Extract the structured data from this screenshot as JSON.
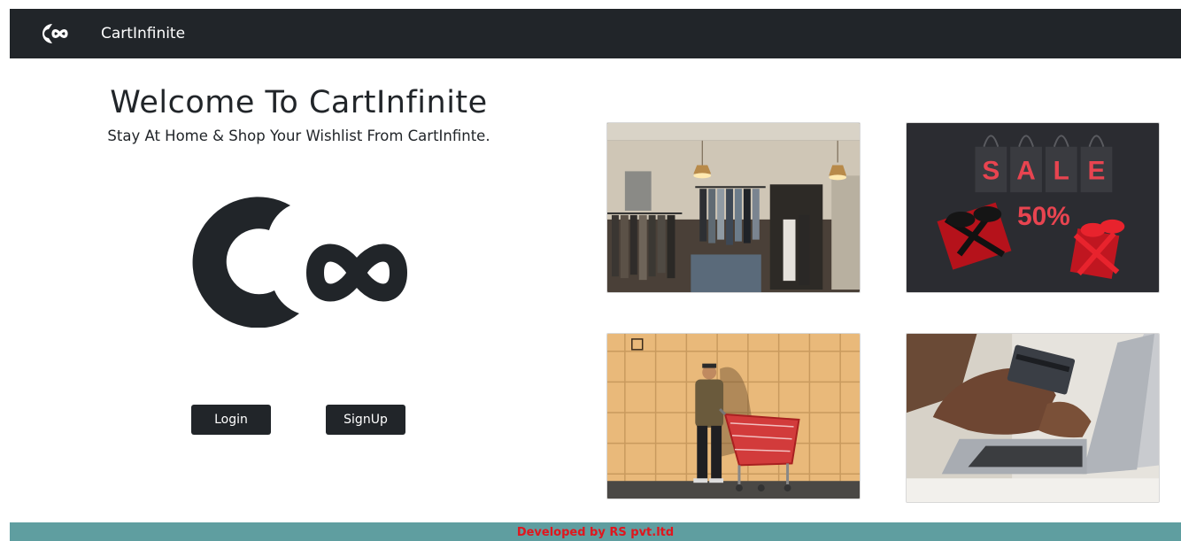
{
  "navbar": {
    "brand": "CartInfinite",
    "logo_icon": "cart-infinite-logo-icon"
  },
  "hero": {
    "title": "Welcome To CartInfinite",
    "subtitle": "Stay At Home & Shop Your Wishlist From CartInfinte.",
    "logo_icon": "cart-infinite-logo-icon"
  },
  "buttons": {
    "login": "Login",
    "signup": "SignUp"
  },
  "gallery": {
    "sale_bag_letters": [
      "S",
      "A",
      "L",
      "E"
    ],
    "sale_percent": "50%"
  },
  "footer": {
    "text": "Developed by RS pvt.ltd"
  },
  "colors": {
    "navbar_bg": "#212529",
    "button_bg": "#212529",
    "footer_bg": "#5f9ea0",
    "footer_text": "#e0161d"
  }
}
